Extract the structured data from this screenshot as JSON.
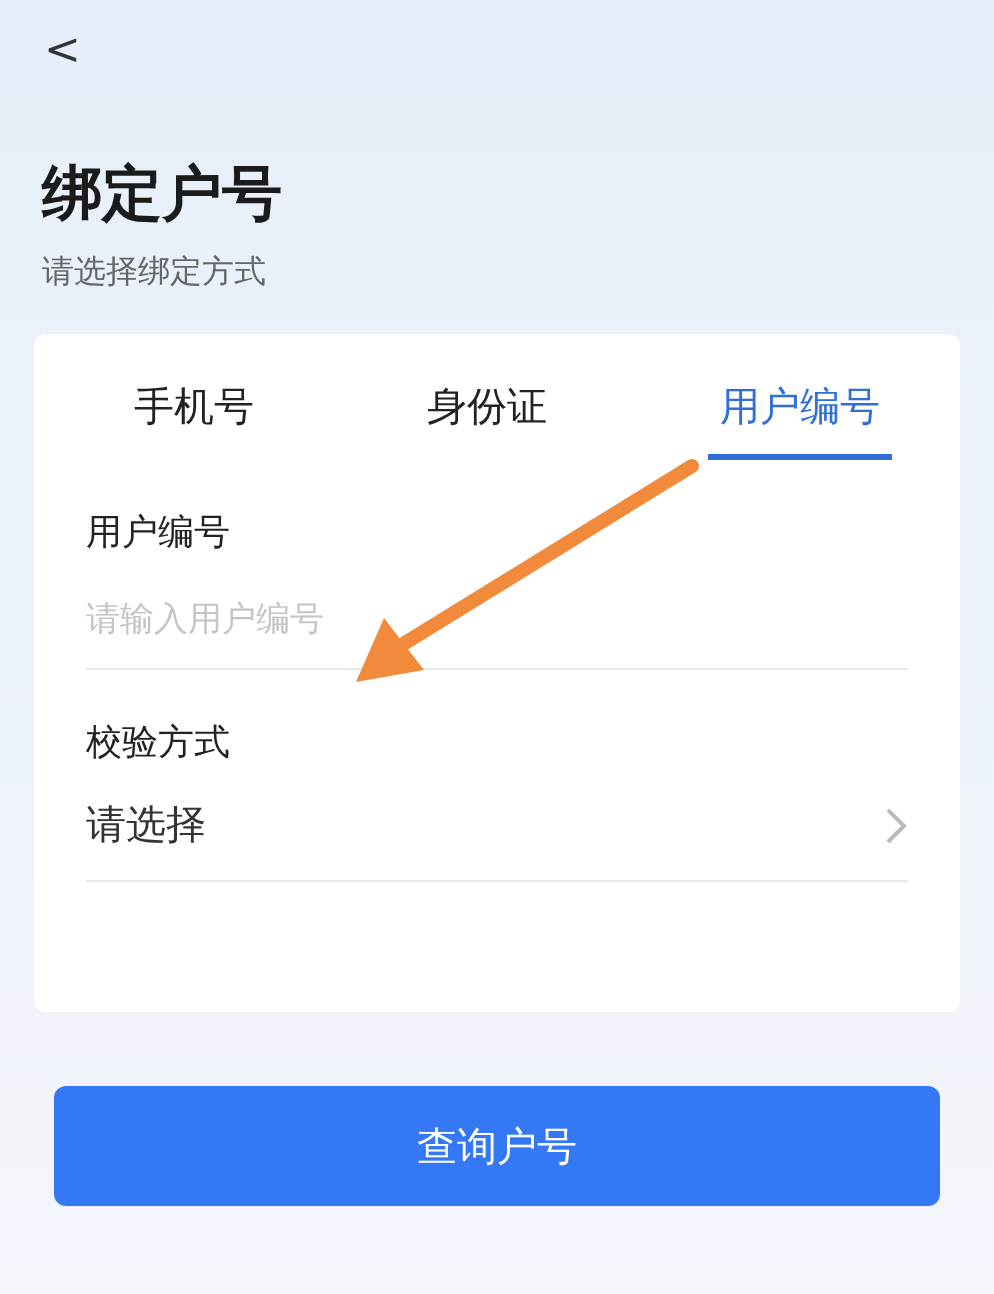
{
  "header": {
    "back": "<",
    "title": "绑定户号",
    "subtitle": "请选择绑定方式"
  },
  "tabs": [
    {
      "label": "手机号",
      "selected": false
    },
    {
      "label": "身份证",
      "selected": false
    },
    {
      "label": "用户编号",
      "selected": true
    }
  ],
  "fields": [
    {
      "kind": "input",
      "label": "用户编号",
      "placeholder": "请输入用户编号"
    },
    {
      "kind": "select",
      "label": "校验方式",
      "value": "请选择"
    }
  ],
  "button": "查询户号"
}
